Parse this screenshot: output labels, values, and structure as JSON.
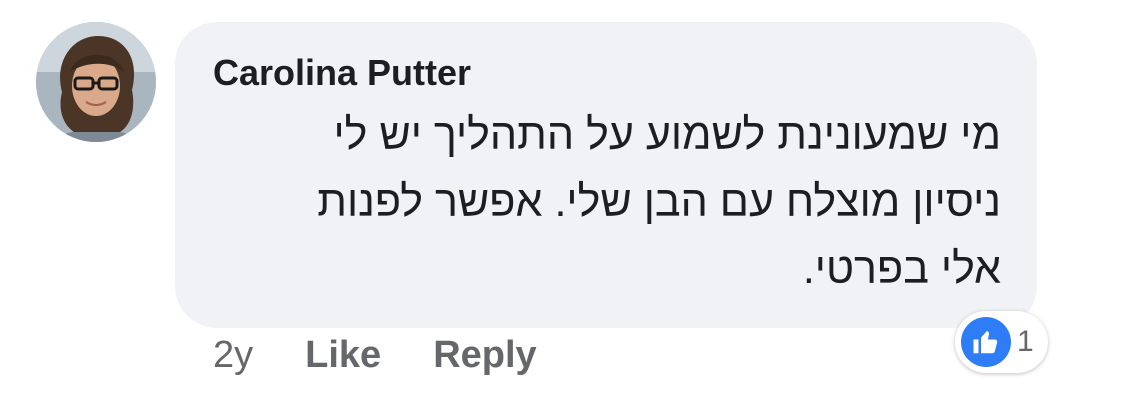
{
  "comment": {
    "author": "Carolina Putter",
    "text_lines": [
      "מי שמעונינת לשמוע על התהליך יש לי",
      "ניסיון מוצלח עם הבן שלי. אפשר לפנות",
      "אלי בפרטי."
    ],
    "timestamp": "2y",
    "actions": {
      "like_label": "Like",
      "reply_label": "Reply"
    },
    "reactions": {
      "icon": "thumbs-up-icon",
      "count": "1"
    }
  },
  "colors": {
    "bubble_bg": "#f0f2f5",
    "text": "#1c1e21",
    "secondary_text": "#65676b",
    "like_blue": "#2e7cf6"
  }
}
